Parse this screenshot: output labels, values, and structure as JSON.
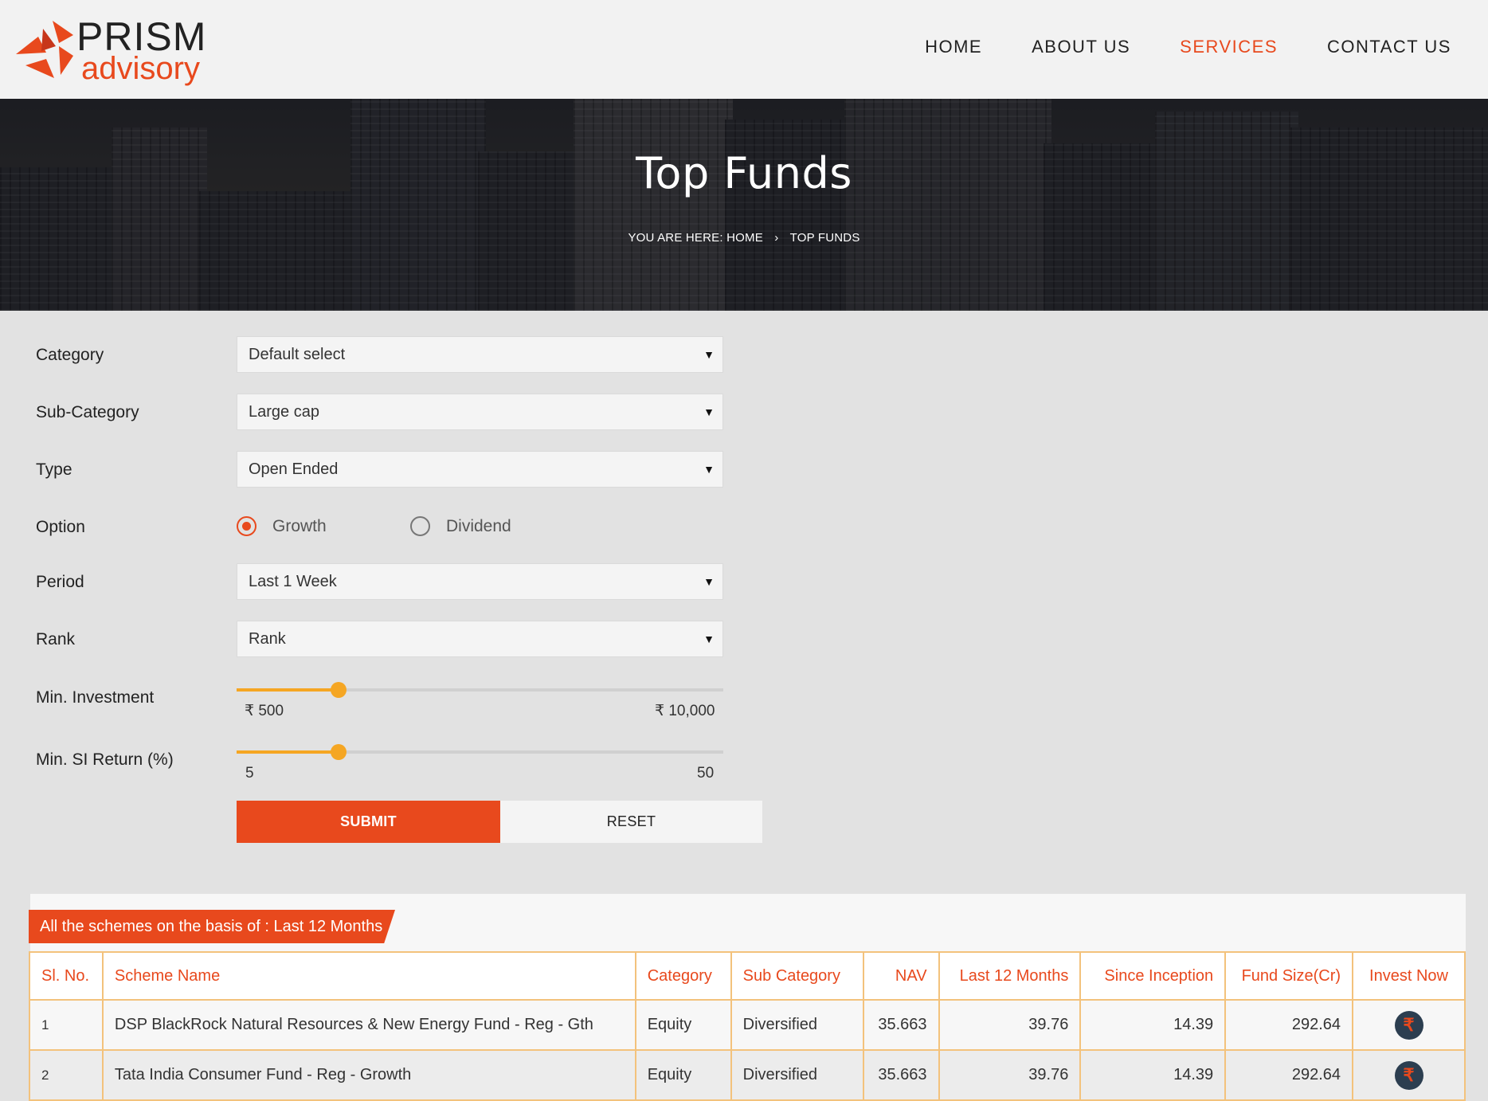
{
  "brand": {
    "line1": "PRISM",
    "line2": "advisory"
  },
  "nav": [
    {
      "label": "HOME"
    },
    {
      "label": "ABOUT US"
    },
    {
      "label": "SERVICES"
    },
    {
      "label": "CONTACT US"
    }
  ],
  "hero": {
    "title": "Top Funds",
    "breadcrumb_prefix": "YOU ARE HERE:",
    "breadcrumb_home": "HOME",
    "breadcrumb_sep": "›",
    "breadcrumb_current": "TOP FUNDS"
  },
  "form": {
    "category": {
      "label": "Category",
      "value": "Default select"
    },
    "subcategory": {
      "label": "Sub-Category",
      "value": "Large cap"
    },
    "type": {
      "label": "Type",
      "value": "Open Ended"
    },
    "option": {
      "label": "Option",
      "choices": [
        "Growth",
        "Dividend"
      ],
      "selected": "Growth"
    },
    "period": {
      "label": "Period",
      "value": "Last 1 Week"
    },
    "rank": {
      "label": "Rank",
      "value": "Rank"
    },
    "min_investment": {
      "label": "Min. Investment",
      "min_label": "₹ 500",
      "max_label": "₹ 10,000",
      "level": 0.21
    },
    "min_si_return": {
      "label": "Min. SI Return (%)",
      "min_label": "5",
      "max_label": "50",
      "level": 0.21
    },
    "submit_label": "SUBMIT",
    "reset_label": "RESET",
    "caret": "▼"
  },
  "results": {
    "heading": "All the schemes on the basis of : Last 12 Months",
    "columns": [
      "Sl. No.",
      "Scheme Name",
      "Category",
      "Sub Category",
      "NAV",
      "Last 12 Months",
      "Since Inception",
      "Fund Size(Cr)",
      "Invest Now"
    ],
    "rows": [
      {
        "sl": "1",
        "scheme": "DSP BlackRock Natural Resources & New Energy Fund - Reg - Gth",
        "category": "Equity",
        "subcategory": "Diversified",
        "nav": "35.663",
        "last12": "39.76",
        "since": "14.39",
        "size": "292.64"
      },
      {
        "sl": "2",
        "scheme": "Tata India Consumer Fund - Reg - Growth",
        "category": "Equity",
        "subcategory": "Diversified",
        "nav": "35.663",
        "last12": "39.76",
        "since": "14.39",
        "size": "292.64"
      }
    ],
    "invest_icon": "₹"
  },
  "colors": {
    "accent": "#e8491d",
    "slider": "#f5a623",
    "table_border": "#f3c27c"
  }
}
